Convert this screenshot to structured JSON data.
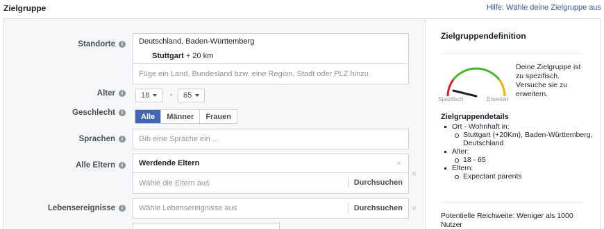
{
  "header": {
    "title": "Zielgruppe",
    "help_link": "Hilfe: Wähle deine Zielgruppe aus"
  },
  "form": {
    "locations": {
      "label": "Standorte",
      "country": "Deutschland, Baden-Württemberg",
      "city": "Stuttgart",
      "radius": "+ 20 km",
      "placeholder": "Füge ein Land, Bundesland bzw. eine Region, Stadt oder PLZ hinzu"
    },
    "age": {
      "label": "Alter",
      "min": "18",
      "max": "65",
      "separator": "-"
    },
    "gender": {
      "label": "Geschlecht",
      "options": [
        "Alle",
        "Männer",
        "Frauen"
      ],
      "selected": "Alle"
    },
    "languages": {
      "label": "Sprachen",
      "placeholder": "Gib eine Sprache ein ..."
    },
    "parents": {
      "label": "Alle Eltern",
      "selected": "Werdende Eltern",
      "placeholder": "Wähle die Eltern aus",
      "browse": "Durchsuchen",
      "clear": "×",
      "remove": "×"
    },
    "life_events": {
      "label": "Lebensereignisse",
      "placeholder": "Wähle Lebensereignisse aus",
      "browse": "Durchsuchen",
      "remove": "×"
    }
  },
  "sidebar": {
    "title": "Zielgruppendefinition",
    "gauge": {
      "left_label": "Spezifisch",
      "right_label": "Erweitert",
      "message": "Deine Zielgruppe ist zu spezifisch. Versuche sie zu erweitern.",
      "level": 0.1,
      "colors": {
        "low": "#e02020",
        "mid": "#f0b000",
        "high": "#42b72a"
      }
    },
    "details_title": "Zielgruppendetails",
    "details": [
      {
        "label": "Ort - Wohnhaft in:",
        "items": [
          "Stuttgart (+20Km), Baden-Württemberg, Deutschland"
        ]
      },
      {
        "label": "Alter:",
        "items": [
          "18 - 65"
        ]
      },
      {
        "label": "Eltern:",
        "items": [
          "Expectant parents"
        ]
      }
    ],
    "reach": "Potentielle Reichweite: Weniger als 1000 Nutzer"
  },
  "colors": {
    "accent": "#4267b2",
    "link": "#365899"
  }
}
